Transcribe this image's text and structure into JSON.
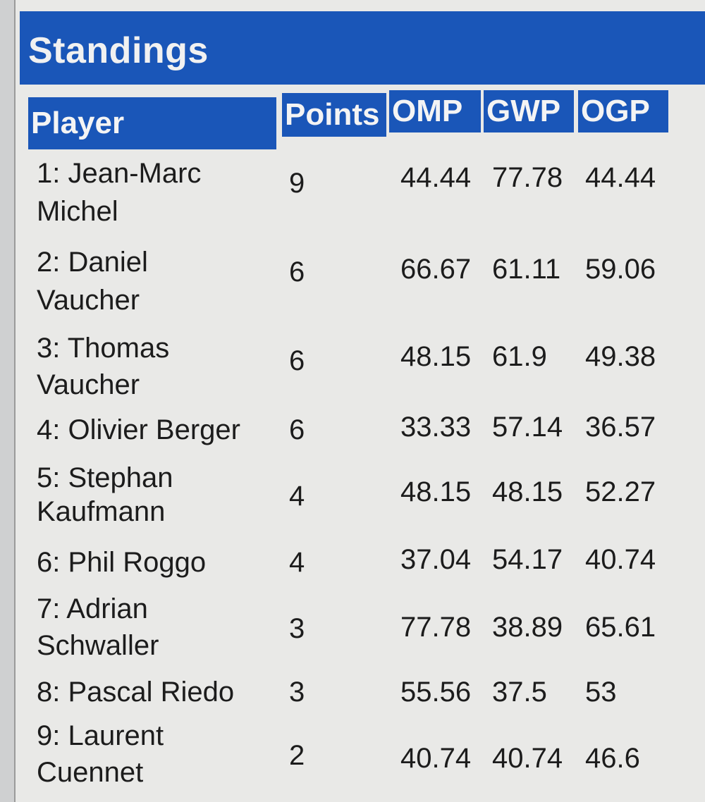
{
  "title": "Standings",
  "columns": {
    "player": "Player",
    "points": "Points",
    "omp": "OMP",
    "gwp": "GWP",
    "ogp": "OGP"
  },
  "rows": [
    {
      "name_line1": "1: Jean-Marc",
      "name_line2": "Michel",
      "points": "9",
      "omp": "44.44",
      "gwp": "77.78",
      "ogp": "44.44"
    },
    {
      "name_line1": "2: Daniel",
      "name_line2": "Vaucher",
      "points": "6",
      "omp": "66.67",
      "gwp": "61.11",
      "ogp": "59.06"
    },
    {
      "name_line1": "3: Thomas",
      "name_line2": "Vaucher",
      "points": "6",
      "omp": "48.15",
      "gwp": "61.9",
      "ogp": "49.38"
    },
    {
      "name_line1": "4: Olivier Berger",
      "name_line2": "",
      "points": "6",
      "omp": "33.33",
      "gwp": "57.14",
      "ogp": "36.57"
    },
    {
      "name_line1": "5: Stephan",
      "name_line2": "Kaufmann",
      "points": "4",
      "omp": "48.15",
      "gwp": "48.15",
      "ogp": "52.27"
    },
    {
      "name_line1": "6: Phil Roggo",
      "name_line2": "",
      "points": "4",
      "omp": "37.04",
      "gwp": "54.17",
      "ogp": "40.74"
    },
    {
      "name_line1": "7: Adrian",
      "name_line2": "Schwaller",
      "points": "3",
      "omp": "77.78",
      "gwp": "38.89",
      "ogp": "65.61"
    },
    {
      "name_line1": "8: Pascal Riedo",
      "name_line2": "",
      "points": "3",
      "omp": "55.56",
      "gwp": "37.5",
      "ogp": "53"
    },
    {
      "name_line1": "9: Laurent",
      "name_line2": "Cuennet",
      "points": "2",
      "omp": "40.74",
      "gwp": "40.74",
      "ogp": "46.6"
    }
  ],
  "colors": {
    "header_blue": "#1a56b8",
    "background": "#e9e9e7",
    "text": "#1c1c1c"
  }
}
